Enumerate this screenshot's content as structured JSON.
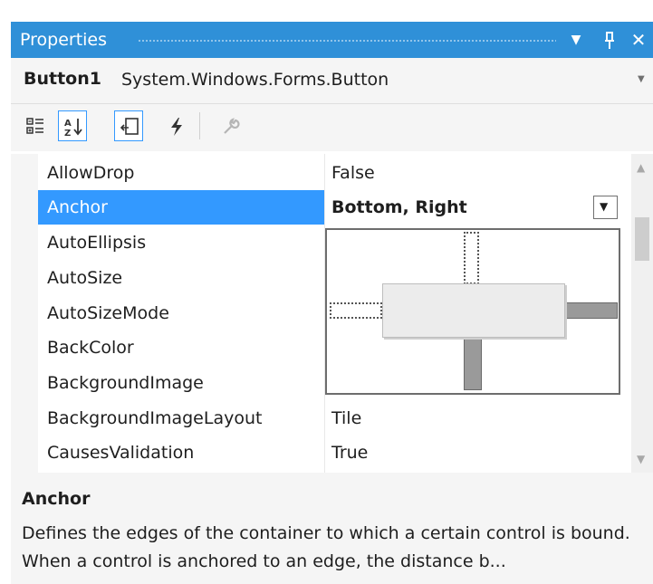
{
  "window": {
    "title": "Properties"
  },
  "title_icons": {
    "dropdown": "chevron-down-icon",
    "pin": "pin-icon",
    "close": "close-icon"
  },
  "object": {
    "name": "Button1",
    "type": "System.Windows.Forms.Button"
  },
  "toolbar": {
    "buttons": [
      {
        "name": "categorized-icon",
        "active": false
      },
      {
        "name": "alphabetical-icon",
        "active": true
      },
      {
        "name": "properties-icon",
        "active": true
      },
      {
        "name": "events-icon",
        "active": false
      },
      {
        "name": "property-pages-icon",
        "active": false
      }
    ]
  },
  "properties": [
    {
      "name": "AllowDrop",
      "value": "False"
    },
    {
      "name": "Anchor",
      "value": "Bottom, Right",
      "selected": true
    },
    {
      "name": "AutoEllipsis",
      "value": ""
    },
    {
      "name": "AutoSize",
      "value": ""
    },
    {
      "name": "AutoSizeMode",
      "value": ""
    },
    {
      "name": "BackColor",
      "value": ""
    },
    {
      "name": "BackgroundImage",
      "value": ""
    },
    {
      "name": "BackgroundImageLayout",
      "value": "Tile"
    },
    {
      "name": "CausesValidation",
      "value": "True"
    }
  ],
  "anchor_editor": {
    "top": false,
    "left": false,
    "right": true,
    "bottom": true
  },
  "description": {
    "title": "Anchor",
    "text": "Defines the edges of the container to which a certain control is bound. When a control is anchored to an edge, the distance b..."
  },
  "colors": {
    "accent": "#2f90d8",
    "selection": "#3399ff"
  }
}
